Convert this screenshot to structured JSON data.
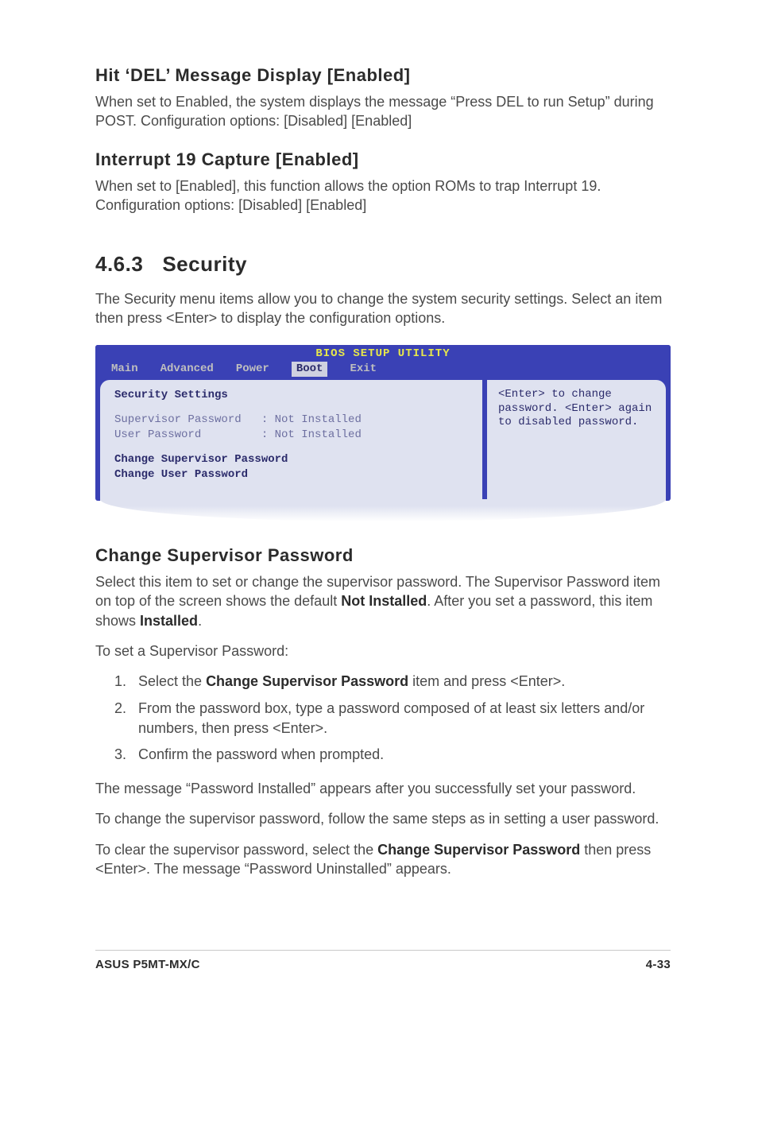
{
  "s1": {
    "heading": "Hit ‘DEL’ Message Display [Enabled]",
    "text": "When set to Enabled, the system displays the message “Press DEL to run Setup” during POST. Configuration options: [Disabled] [Enabled]"
  },
  "s2": {
    "heading": "Interrupt 19 Capture [Enabled]",
    "text": "When set to [Enabled], this function allows the option ROMs to trap Interrupt 19. Configuration options: [Disabled] [Enabled]"
  },
  "sec": {
    "num": "4.6.3",
    "title": "Security",
    "intro": "The Security menu items allow you to change the system security settings. Select an item then press <Enter> to display the configuration options."
  },
  "bios": {
    "title": "BIOS SETUP UTILITY",
    "tabs": [
      "Main",
      "Advanced",
      "Power",
      "Boot",
      "Exit"
    ],
    "active_tab_index": 3,
    "left": {
      "heading": "Security Settings",
      "line1": "Supervisor Password   : Not Installed",
      "line2": "User Password         : Not Installed",
      "action1": "Change Supervisor Password",
      "action2": "Change User Password"
    },
    "right": {
      "help": "<Enter> to change password.\n<Enter> again to disabled password."
    }
  },
  "csp": {
    "heading": "Change Supervisor Password",
    "p1a": "Select this item to set or change the supervisor password. The Supervisor Password item on top of the screen shows the default ",
    "p1b": "Not Installed",
    "p1c": ". After you set a password, this item shows ",
    "p1d": "Installed",
    "p1e": ".",
    "p2": "To set a Supervisor Password:",
    "steps": [
      {
        "pre": "Select the ",
        "bold": "Change Supervisor Password",
        "post": " item and press <Enter>."
      },
      {
        "pre": "From the password box, type a password composed of at least six letters and/or numbers, then press <Enter>.",
        "bold": "",
        "post": ""
      },
      {
        "pre": "Confirm the password when prompted.",
        "bold": "",
        "post": ""
      }
    ],
    "p3": "The message “Password Installed” appears after you successfully set your password.",
    "p4": "To change the supervisor password, follow the same steps as in setting a user password.",
    "p5a": "To clear the supervisor password, select the ",
    "p5b": "Change Supervisor Password",
    "p5c": " then press <Enter>. The message “Password Uninstalled” appears."
  },
  "footer": {
    "left": "ASUS P5MT-MX/C",
    "right": "4-33"
  }
}
